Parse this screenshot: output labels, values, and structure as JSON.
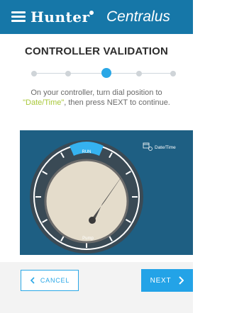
{
  "header": {
    "brand": "Hunter",
    "app_name": "Centralus"
  },
  "page": {
    "title": "CONTROLLER VALIDATION",
    "progress": {
      "total_steps": 5,
      "current_step": 3
    },
    "instruction": {
      "before": "On your controller, turn dial position to ",
      "highlight": "\"Date/Time\"",
      "after": ", then press NEXT to continue."
    }
  },
  "dial": {
    "top_label": "RUN",
    "side_label": "Date/Time",
    "bottom_label": "Pump"
  },
  "footer": {
    "cancel_label": "CANCEL",
    "next_label": "NEXT"
  },
  "colors": {
    "header_bg": "#1677a8",
    "accent": "#2aa7e6",
    "highlight": "#a9c83a",
    "dial_bg": "#1e5f83"
  },
  "icons": {
    "menu": "hamburger-menu-icon",
    "date_time": "calendar-clock-icon",
    "cancel": "chevron-left-icon",
    "next": "chevron-right-icon"
  }
}
